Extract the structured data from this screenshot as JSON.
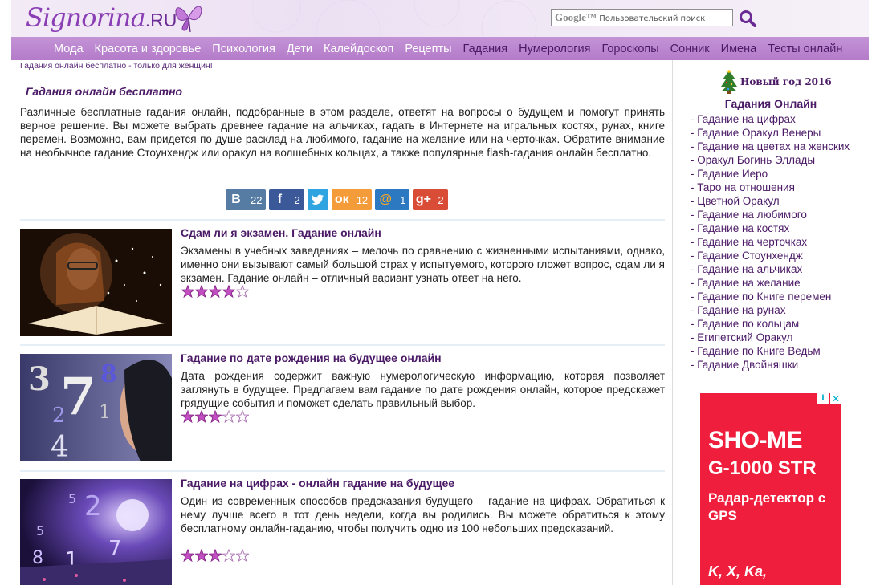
{
  "header": {
    "logo_main": "Signorina",
    "logo_ru": ".RU",
    "search_brand": "Google™",
    "search_placeholder": "Пользовательский поиск"
  },
  "nav": [
    {
      "label": "Мода",
      "active": false
    },
    {
      "label": "Красота и здоровье",
      "active": false
    },
    {
      "label": "Психология",
      "active": false
    },
    {
      "label": "Дети",
      "active": false
    },
    {
      "label": "Калейдоскоп",
      "active": false
    },
    {
      "label": "Рецепты",
      "active": false
    },
    {
      "label": "Гадания",
      "active": true
    },
    {
      "label": "Нумерология",
      "active": true
    },
    {
      "label": "Гороскопы",
      "active": true
    },
    {
      "label": "Сонник",
      "active": true
    },
    {
      "label": "Имена",
      "active": true
    },
    {
      "label": "Тесты онлайн",
      "active": true
    }
  ],
  "tagline": "Гадания онлайн бесплатно - только для женщин!",
  "main": {
    "title": "Гадания онлайн бесплатно",
    "intro": "Различные бесплатные гадания онлайн, подобранные в этом разделе, ответят на вопросы о будущем и помогут принять верное решение. Вы можете выбрать древнее гадание на альчиках, гадать в Интернете на игральных костях, рунах, книге перемен. Возможно, вам придется по душе расклад на любимого, гадание на желание или на черточках. Обратите внимание на необычное гадание Стоунхендж или оракул на волшебных кольцах, а также популярные flash-гадания онлайн бесплатно."
  },
  "share": [
    {
      "name": "vk",
      "icon": "B",
      "count": "22",
      "color": "#567ca4"
    },
    {
      "name": "facebook",
      "icon": "f",
      "count": "2",
      "color": "#3b5998"
    },
    {
      "name": "twitter",
      "icon": "t",
      "count": "",
      "color": "#2fa4e0"
    },
    {
      "name": "odnoklassniki",
      "icon": "ок",
      "count": "12",
      "color": "#f59c3a"
    },
    {
      "name": "mailru",
      "icon": "@",
      "count": "1",
      "color": "#2c79c2"
    },
    {
      "name": "googleplus",
      "icon": "g+",
      "count": "2",
      "color": "#d94d36"
    }
  ],
  "articles": [
    {
      "title": "Сдам ли я экзамен. Гадание онлайн",
      "desc": "Экзамены в учебных заведениях – мелочь по сравнению с жизненными испытаниями, однако, именно они вызывают самый большой страх у испытуемого, которого гложет вопрос, сдам ли я экзамен. Гадание онлайн – отличный вариант узнать ответ на него.",
      "rating": 4
    },
    {
      "title": "Гадание по дате рождения на будущее онлайн",
      "desc": "Дата рождения содержит важную нумерологическую информацию, которая позволяет заглянуть в будущее. Предлагаем вам гадание по дате рождения онлайн, которое предскажет грядущие события и поможет сделать правильный выбор.",
      "rating": 3
    },
    {
      "title": "Гадание на цифрах - онлайн гадание на будущее",
      "desc": "Один из современных способов предсказания будущего – гадание на цифрах. Обратиться к нему лучше всего в тот день недели, когда вы родились. Вы можете обратиться к этому бесплатному онлайн-гаданию, чтобы получить одно из 100 небольших предсказаний.",
      "rating": 3
    }
  ],
  "sidebar": {
    "new_year": "Новый год 2016",
    "title": "Гадания Онлайн",
    "links": [
      "- Гадание на цифрах",
      "- Гадание Оракул Венеры",
      "- Гадание на цветах на женских",
      "- Оракул Богинь Эллады",
      "- Гадание Иеро",
      "- Таро на отношения",
      "- Цветной Оракул",
      "- Гадание на любимого",
      "- Гадание на костях",
      "- Гадание на черточках",
      "- Гадание Стоунхендж",
      "- Гадание на альчиках",
      "- Гадание на желание",
      "- Гадание по Книге перемен",
      "- Гадание на рунах",
      "- Гадание по кольцам",
      "- Египетский Оракул",
      "- Гадание по Книге Ведьм",
      "- Гадание Двойняшки"
    ]
  },
  "ad": {
    "line1": "SHO-ME",
    "line2": "G-1000 STR",
    "line3": "Радар-детектор с GPS",
    "line4": "K, X, Ka,"
  },
  "colors": {
    "accent": "#4b1a66",
    "nav_bg": "#b983cc",
    "ad_bg": "#ef1e3c"
  }
}
